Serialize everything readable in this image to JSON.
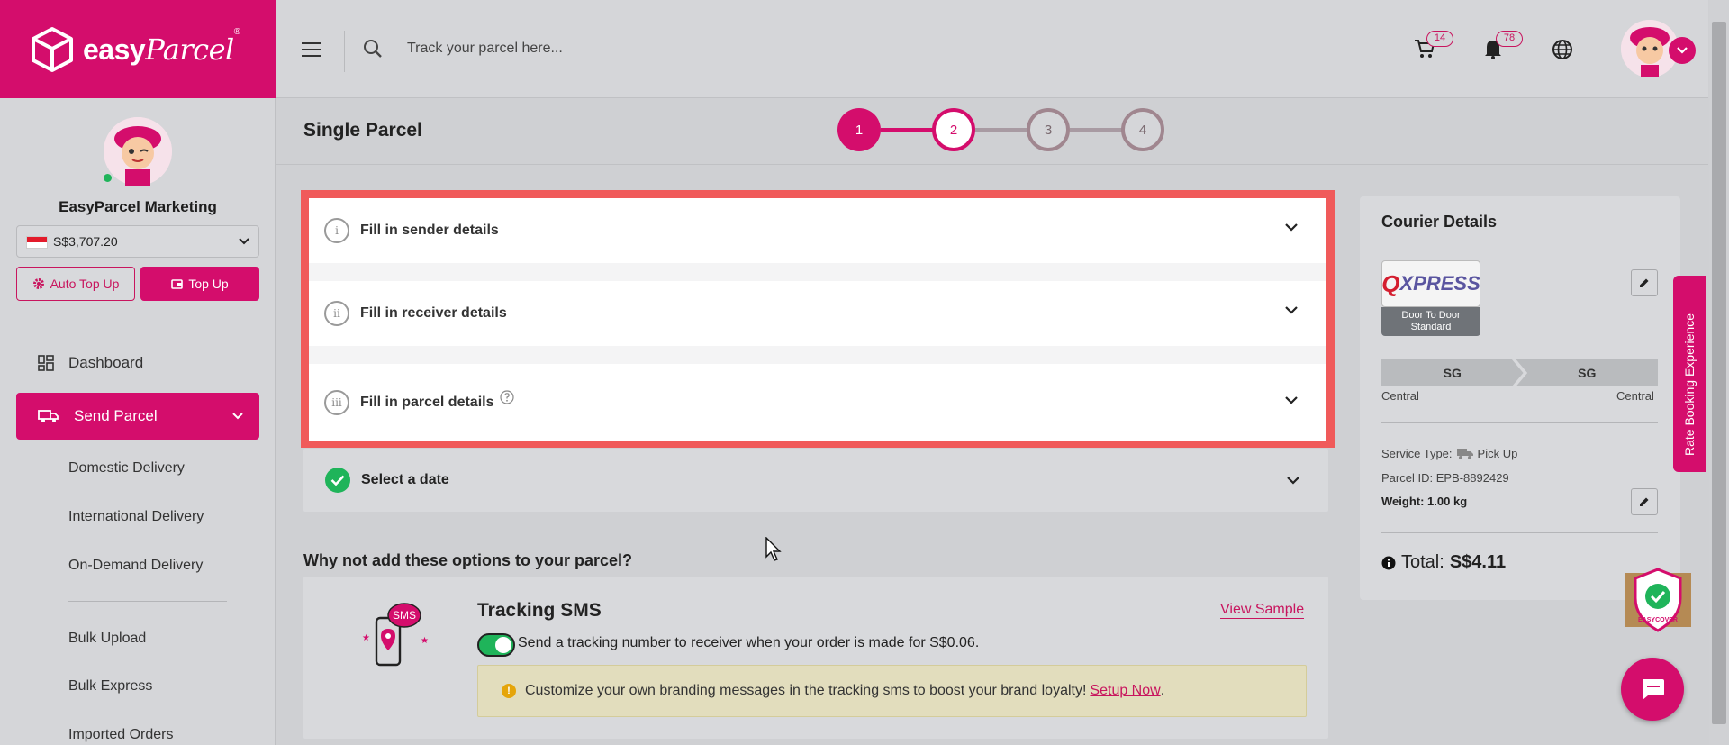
{
  "brand": {
    "name_bold": "easy",
    "name_script": "Parcel",
    "reg": "®",
    "accent": "#d40d6c"
  },
  "header": {
    "search_placeholder": "Track your parcel here...",
    "cart_count": "14",
    "notif_count": "78"
  },
  "sidebar": {
    "user_name": "EasyParcel Marketing",
    "balance": "S$3,707.20",
    "auto_topup": "Auto Top Up",
    "topup": "Top Up",
    "nav": {
      "dashboard": "Dashboard",
      "send_parcel": "Send Parcel"
    },
    "sub_items": [
      "Domestic Delivery",
      "International Delivery",
      "On-Demand Delivery",
      "Bulk Upload",
      "Bulk Express",
      "Imported Orders"
    ]
  },
  "main": {
    "title": "Single Parcel",
    "steps": [
      "1",
      "2",
      "3",
      "4"
    ],
    "accordion": [
      {
        "numeral": "i",
        "label": "Fill in sender details"
      },
      {
        "numeral": "ii",
        "label": "Fill in receiver details"
      },
      {
        "numeral": "iii",
        "label": "Fill in parcel details"
      }
    ],
    "date_label": "Select a date",
    "options_title": "Why not add these options to your parcel?",
    "sms": {
      "icon_text": "SMS",
      "title": "Tracking SMS",
      "view_sample": "View Sample",
      "description": "Send a tracking number to receiver when your order is made for S$0.06.",
      "info": "Customize your own branding messages in the tracking sms to boost your brand loyalty!",
      "setup_link": "Setup Now",
      "setup_suffix": "."
    }
  },
  "courier": {
    "title": "Courier Details",
    "logo_q": "Q",
    "logo_text": "XPRESS",
    "service": "Door To Door Standard",
    "from_code": "SG",
    "to_code": "SG",
    "from_region": "Central",
    "to_region": "Central",
    "service_type_label": "Service Type:",
    "service_type_value": "Pick Up",
    "parcel_id_label": "Parcel ID:",
    "parcel_id_value": "EPB-8892429",
    "weight_label": "Weight:",
    "weight_value": "1.00 kg",
    "total_label": "Total:",
    "total_value": "S$4.11"
  },
  "rate_tab": "Rate Booking Experience",
  "easycover": "EASYCOVER"
}
